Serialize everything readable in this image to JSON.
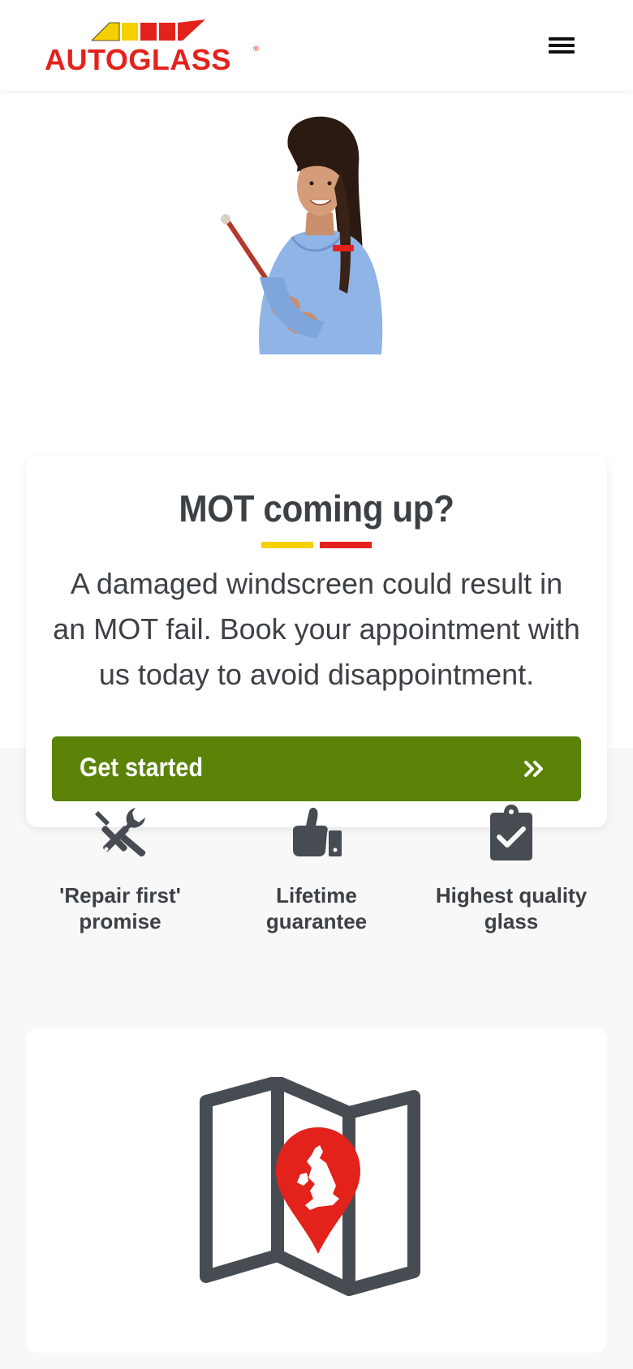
{
  "header": {
    "logo_text": "AUTOGLASS",
    "logo_mark": "®",
    "menu_icon": "hamburger-menu-icon",
    "brand_colors": {
      "red": "#e3221b",
      "yellow": "#f5d000"
    }
  },
  "hero": {
    "image_alt": "Autoglass technician holding a clipboard",
    "card": {
      "title": "MOT coming up?",
      "body": "A damaged windscreen could result in an MOT fail. Book your appointment with us today to avoid disappointment.",
      "cta_label": "Get started",
      "cta_icon": "double-chevron-right-icon",
      "cta_color": "#5a8308"
    }
  },
  "features": [
    {
      "icon": "tools-icon",
      "label": "'Repair first' promise"
    },
    {
      "icon": "thumbs-up-icon",
      "label": "Lifetime guarantee"
    },
    {
      "icon": "clipboard-check-icon",
      "label": "Highest quality glass"
    }
  ],
  "map_card": {
    "icon": "uk-map-pin-icon"
  }
}
